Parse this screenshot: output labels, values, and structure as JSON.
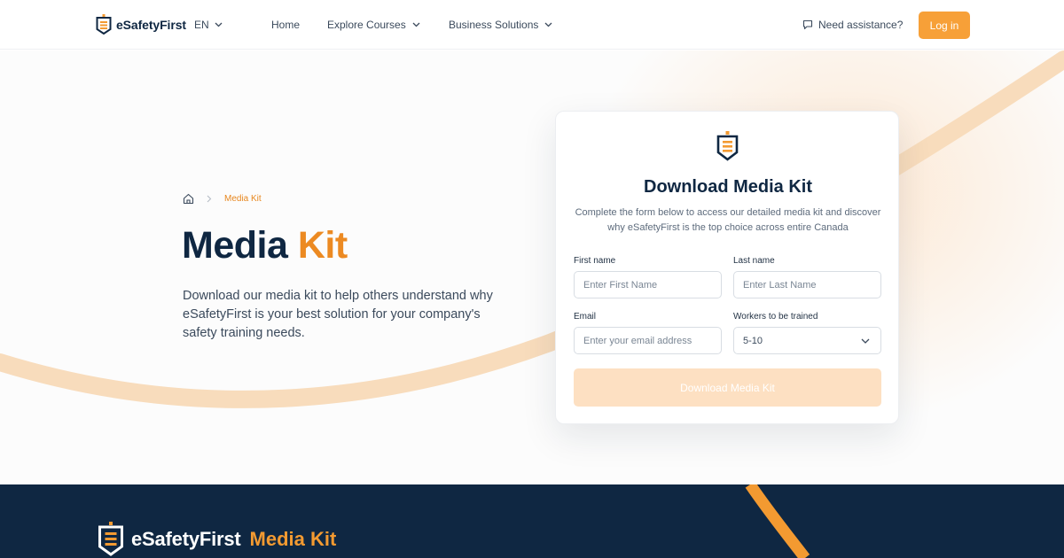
{
  "header": {
    "brand": "eSafetyFirst",
    "language": "EN",
    "nav": [
      {
        "label": "Home"
      },
      {
        "label": "Explore Courses"
      },
      {
        "label": "Business Solutions"
      }
    ],
    "assistance": "Need assistance?",
    "login": "Log in"
  },
  "hero": {
    "breadcrumb_current": "Media Kit",
    "title_part1": "Media",
    "title_part2": "Kit",
    "description": "Download our media kit to help others understand why eSafetyFirst is your best solution for your company's safety training needs."
  },
  "form": {
    "title": "Download Media Kit",
    "subtitle": "Complete the form below to access our detailed media kit and discover why eSafetyFirst is the top choice across entire Canada",
    "first_name": {
      "label": "First name",
      "placeholder": "Enter First Name"
    },
    "last_name": {
      "label": "Last name",
      "placeholder": "Enter Last Name"
    },
    "email": {
      "label": "Email",
      "placeholder": "Enter your email address"
    },
    "workers": {
      "label": "Workers to be trained",
      "value": "5-10"
    },
    "submit": "Download Media Kit"
  },
  "footer": {
    "brand": "eSafetyFirst",
    "kit": "Media Kit"
  },
  "colors": {
    "navy": "#0f2742",
    "orange": "#f7a038",
    "orange_text": "#ec8a22",
    "button_disabled": "#fde0c2"
  }
}
